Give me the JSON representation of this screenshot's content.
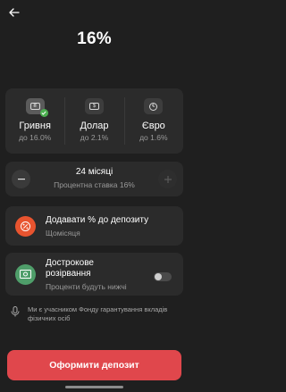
{
  "header": {
    "rate": "16%"
  },
  "currencies": [
    {
      "name": "Гривня",
      "rate": "до 16.0%",
      "symbol": "₴",
      "selected": true
    },
    {
      "name": "Долар",
      "rate": "до 2.1%",
      "symbol": "$",
      "selected": false
    },
    {
      "name": "Євро",
      "rate": "до 1.6%",
      "symbol": "€",
      "selected": false
    }
  ],
  "term": {
    "title": "24 місяці",
    "subtitle": "Процентна ставка 16%"
  },
  "options": [
    {
      "title": "Додавати % до депозиту",
      "subtitle": "Щомісяця",
      "icon": "add-percent-icon",
      "color": "#e8542f"
    },
    {
      "title": "Дострокове розірвання",
      "subtitle": "Проценти будуть нижчі",
      "icon": "cash-icon",
      "color": "#4f9e6a",
      "enabled": false
    }
  ],
  "notice": "Ми є учасником Фонду гарантування вкладів фізичних осіб",
  "submit_label": "Оформити депозит",
  "colors": {
    "accent": "#e0474c",
    "background": "#1f1f1f",
    "card": "#2b2b2b"
  }
}
